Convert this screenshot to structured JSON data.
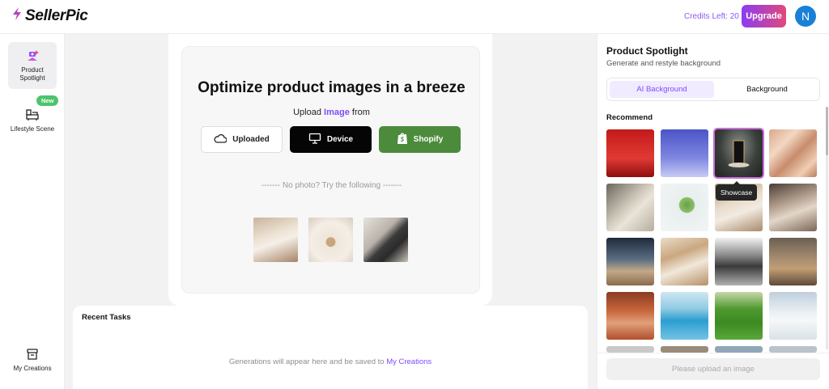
{
  "header": {
    "app_name": "SellerPic",
    "credits": "Credits Left: 20",
    "upgrade_label": "Upgrade",
    "avatar_initial": "N"
  },
  "sidebar": {
    "items": [
      {
        "label": "Product\nSpotlight",
        "icon": "product-spotlight-icon",
        "active": true
      },
      {
        "label": "Lifestyle Scene",
        "icon": "sofa-icon",
        "badge": "New"
      },
      {
        "label": "My Creations",
        "icon": "archive-icon"
      }
    ]
  },
  "upload": {
    "headline": "Optimize product images in a breeze",
    "upload_prefix": "Upload ",
    "upload_highlight": "Image",
    "upload_suffix": " from",
    "buttons": [
      {
        "label": "Uploaded",
        "icon": "cloud-icon"
      },
      {
        "label": "Device",
        "icon": "monitor-icon"
      },
      {
        "label": "Shopify",
        "icon": "shopify-icon"
      }
    ],
    "divider": "------- No photo? Try the following -------",
    "samples": [
      "armchair",
      "perfume-bottle",
      "handbag"
    ]
  },
  "tasks": {
    "title": "Recent Tasks",
    "empty_prefix": "Generations will appear here and be saved to ",
    "empty_link": "My Creations"
  },
  "panel": {
    "title": "Product Spotlight",
    "subtitle": "Generate and restyle background",
    "tabs": [
      "AI Background",
      "Background"
    ],
    "active_tab": "AI Background",
    "recommend_label": "Recommend",
    "tooltip": "Showcase",
    "selected_tile": "Showcase",
    "upload_hint": "Please upload an image"
  },
  "colors": {
    "accent": "#7c4dff",
    "upgrade_from": "#8b3cf3",
    "upgrade_to": "#e14a7a",
    "avatar": "#1a7fd6",
    "shopify": "#4b8b3b",
    "new_badge": "#4cc46c"
  }
}
